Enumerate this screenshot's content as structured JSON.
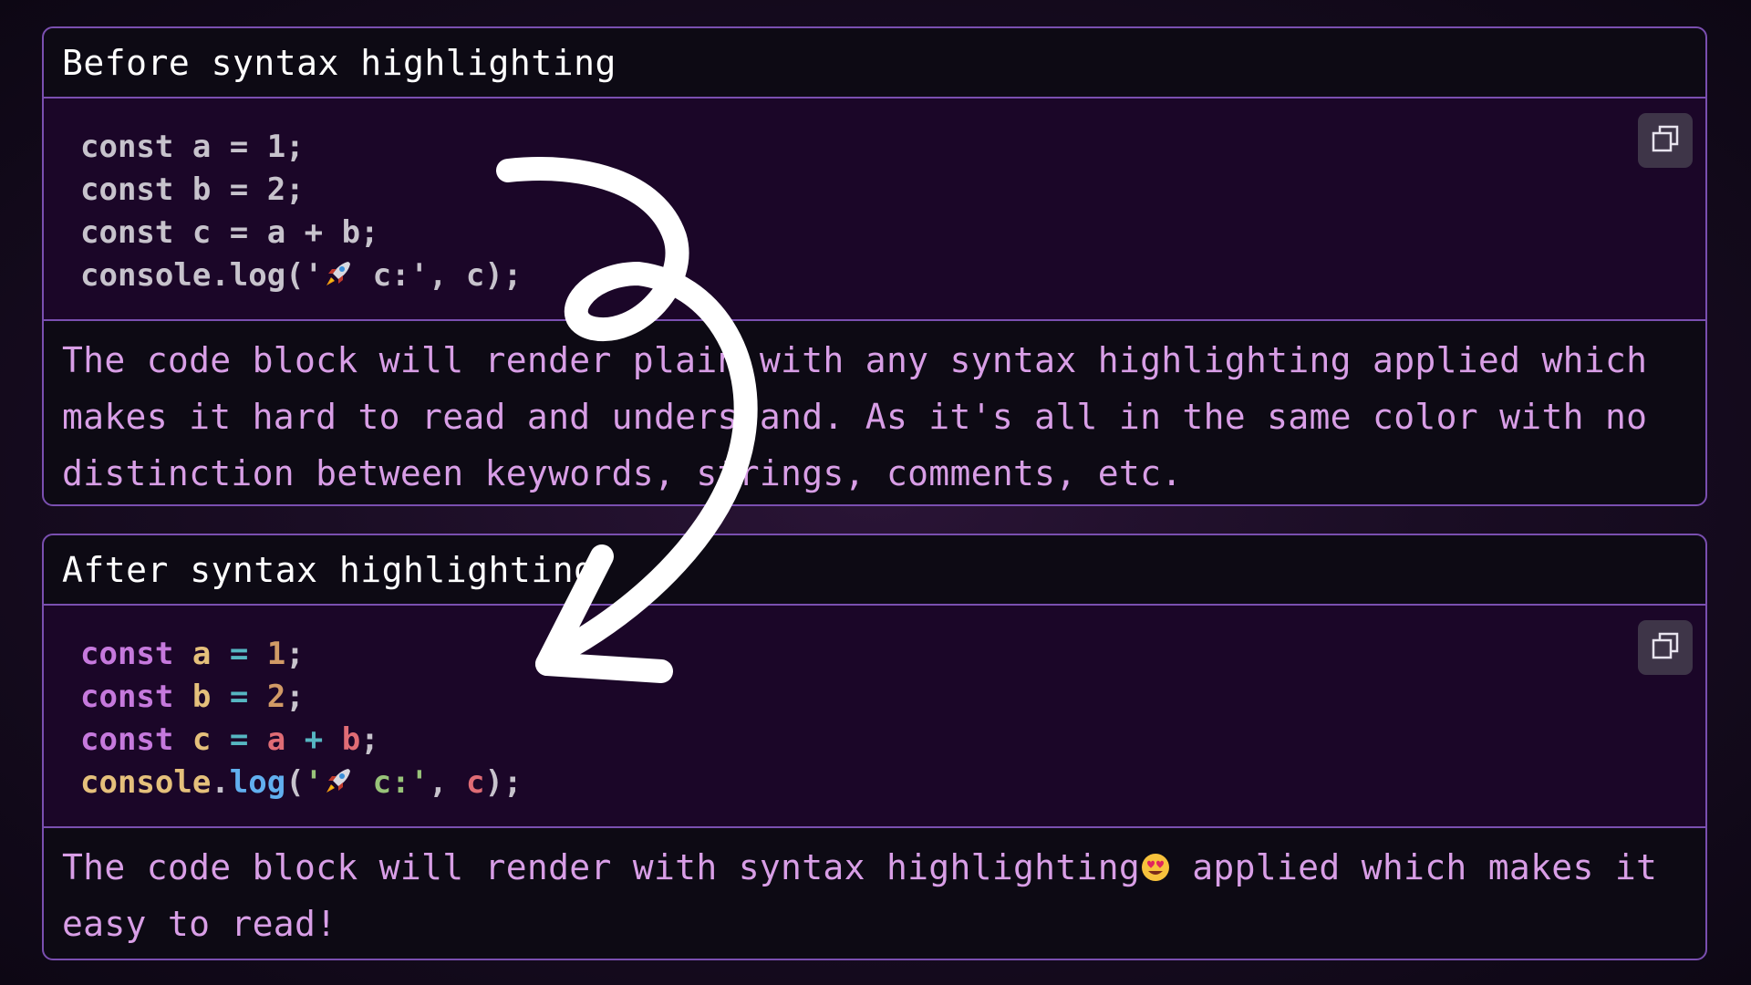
{
  "before": {
    "title": "Before syntax highlighting",
    "code_lines": [
      "const a = 1;",
      "const b = 2;",
      "const c = a + b;"
    ],
    "code_last": {
      "prefix": "console.log('",
      "suffix": " c:', c);"
    },
    "description": "The code block will render plain with any syntax highlighting applied which makes it hard to read and understand. As it's all in the same color with no distinction between keywords, strings, comments, etc."
  },
  "after": {
    "title": "After syntax highlighting",
    "lines": [
      {
        "kw": "const",
        "name": "a",
        "op": "=",
        "val": "1",
        "end": ";"
      },
      {
        "kw": "const",
        "name": "b",
        "op": "=",
        "val": "2",
        "end": ";"
      }
    ],
    "line3": {
      "kw": "const",
      "name": "c",
      "op": "=",
      "left": "a",
      "plus": "+",
      "right": "b",
      "end": ";"
    },
    "line4": {
      "obj": "console",
      "dot": ".",
      "fn": "log",
      "open": "(",
      "str_open": "'",
      "str_text": " c:'",
      "comma": ", ",
      "arg": "c",
      "close": ");"
    },
    "description_before_emoji": "The code block will render with syntax highlighting",
    "description_after_emoji": " applied which makes it easy to read!"
  },
  "copy_button": {
    "icon": "copy-icon"
  },
  "icons": {
    "rocket": "rocket-emoji-icon",
    "heart_eyes": "heart-eyes-emoji-icon"
  },
  "colors": {
    "panel_bg": "#0d0a14",
    "code_bg": "#1b0628",
    "border": "#7a4fb0",
    "description_text": "#d89ee6",
    "keyword": "#c679dd",
    "variable": "#e5c07b",
    "operator": "#56b6c2",
    "number": "#d19a66",
    "string": "#98c379",
    "function": "#61afef",
    "reference": "#e06c75"
  }
}
